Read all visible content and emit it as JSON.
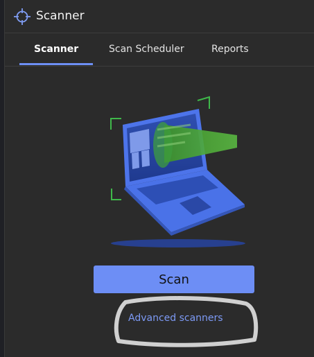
{
  "window": {
    "title": "Scanner",
    "app_icon": "crosshair-icon"
  },
  "tabs": [
    {
      "label": "Scanner",
      "active": true
    },
    {
      "label": "Scan Scheduler",
      "active": false
    },
    {
      "label": "Reports",
      "active": false
    }
  ],
  "illustration": {
    "icon": "laptop-scan-icon"
  },
  "actions": {
    "scan_label": "Scan",
    "advanced_label": "Advanced scanners"
  },
  "colors": {
    "accent": "#6d8ef5",
    "link": "#7d9af5",
    "background": "#2b2b2b",
    "scan_beam": "#4fbf3a"
  }
}
